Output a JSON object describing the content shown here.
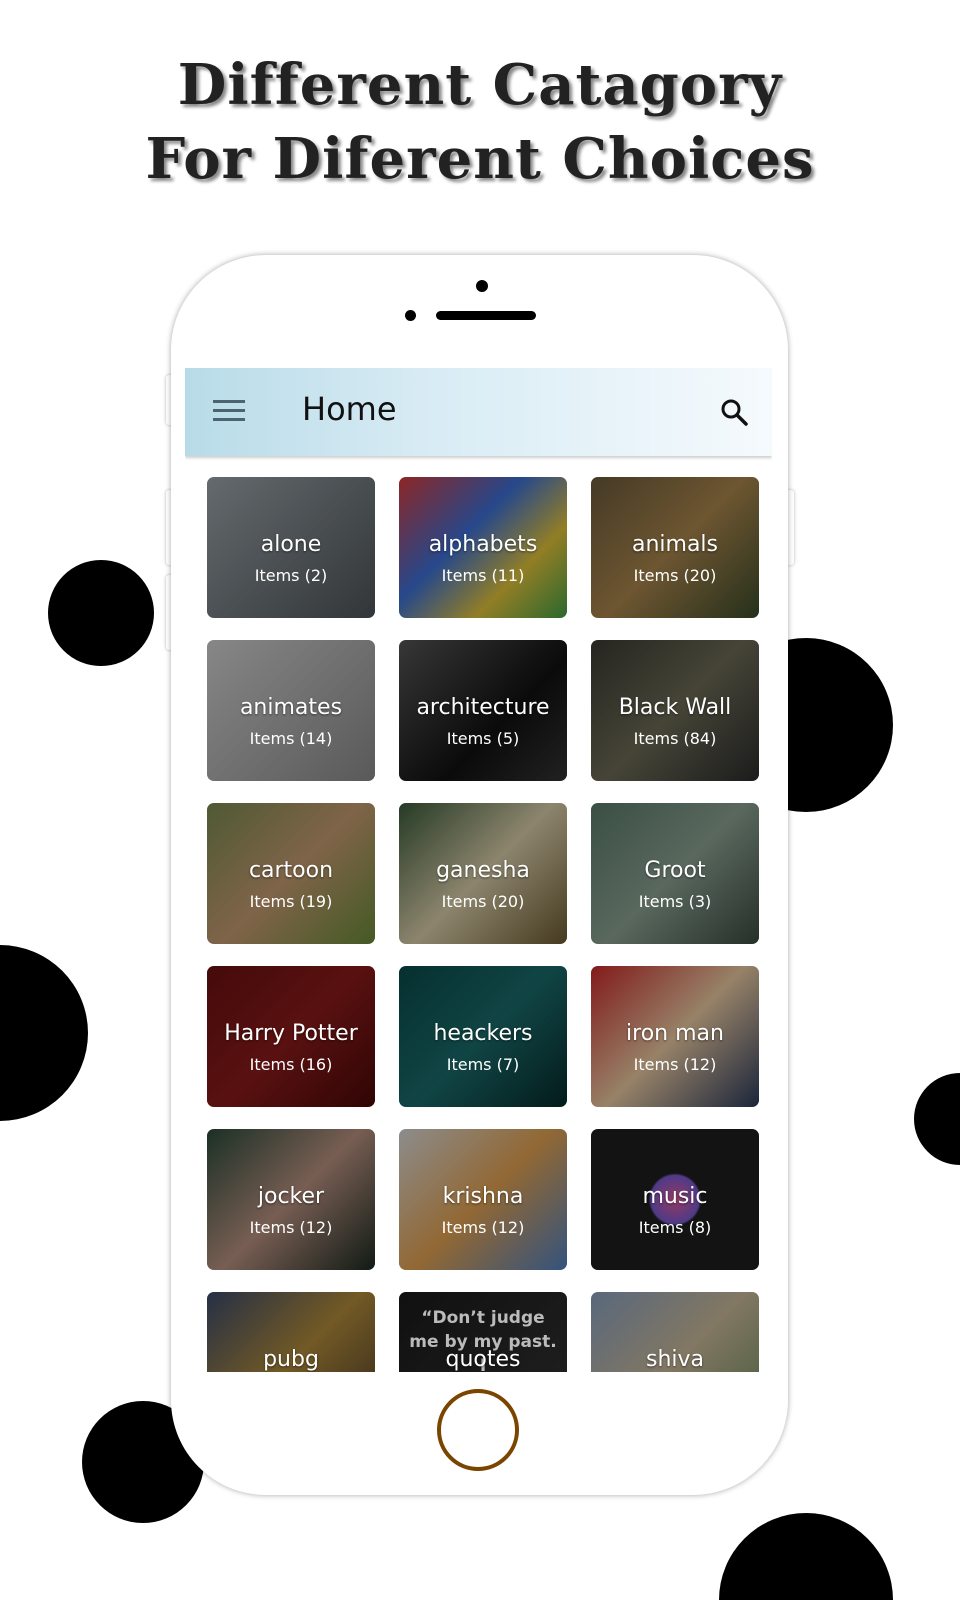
{
  "headline": {
    "line1": "Different Catagory",
    "line2": "For Diferent Choices"
  },
  "app": {
    "title": "Home",
    "menu_icon": "hamburger-menu-icon",
    "search_icon": "search-icon"
  },
  "categories": [
    {
      "name": "alone",
      "count": "Items (2)",
      "bg": "linear-gradient(135deg,#9aa3a8,#4d5358)"
    },
    {
      "name": "alphabets",
      "count": "Items (11)",
      "bg": "linear-gradient(135deg,#d63b3b,#3b6fd6 40%,#e0c23a 70%,#43a047)"
    },
    {
      "name": "animals",
      "count": "Items (20)",
      "bg": "linear-gradient(135deg,#6a5a3a,#a8844c 50%,#3a4a2a)"
    },
    {
      "name": "animates",
      "count": "Items (14)",
      "bg": "linear-gradient(135deg,#cfcfcf,#8a8a8a)"
    },
    {
      "name": "architecture",
      "count": "Items (5)",
      "bg": "linear-gradient(135deg,#555,#111 60%,#333)"
    },
    {
      "name": "Black Wall",
      "count": "Items (84)",
      "bg": "linear-gradient(135deg,#3a3a32,#6b6a55 50%,#2b2b2b)"
    },
    {
      "name": "cartoon",
      "count": "Items (19)",
      "bg": "linear-gradient(135deg,#7a8a50,#c49a70 50%,#6a8a3a)"
    },
    {
      "name": "ganesha",
      "count": "Items (20)",
      "bg": "linear-gradient(135deg,#3a5a3a,#d8cca8 50%,#6a5a30)"
    },
    {
      "name": "Groot",
      "count": "Items (3)",
      "bg": "linear-gradient(135deg,#5a7a6a,#8aa090 50%,#3a4a40)"
    },
    {
      "name": "Harry Potter",
      "count": "Items (16)",
      "bg": "linear-gradient(135deg,#6a1010,#8a1a1a 50%,#4a0808)"
    },
    {
      "name": "heackers",
      "count": "Items (7)",
      "bg": "linear-gradient(135deg,#0a4a4a,#1a6a6a 50%,#062a2a)"
    },
    {
      "name": "iron man",
      "count": "Items (12)",
      "bg": "linear-gradient(135deg,#c82a2a,#e8c8a0 50%,#2a3a5a)"
    },
    {
      "name": "jocker",
      "count": "Items (12)",
      "bg": "linear-gradient(135deg,#2a4a3a,#b89080 50%,#1a2a20)"
    },
    {
      "name": "krishna",
      "count": "Items (12)",
      "bg": "linear-gradient(135deg,#d8d8d8,#e0a050 50%,#5080c0)"
    },
    {
      "name": "music",
      "count": "Items (8)",
      "bg": "radial-gradient(circle at 50% 50%,#e05a9a 0,#7a5ad0 22%,#1e1e1e 24%)"
    },
    {
      "name": "pubg",
      "count": "",
      "bg": "linear-gradient(135deg,#3a4a6a,#b08a3a 50%,#4a3a2a)"
    },
    {
      "name": "quotes",
      "count": "",
      "bg": "linear-gradient(135deg,#1a1a1a,#333)"
    },
    {
      "name": "shiva",
      "count": "",
      "bg": "linear-gradient(135deg,#8aa0c0,#c8b898 50%,#6a8a5a)"
    }
  ],
  "quote_preview": "“Don’t judge me by my past. I"
}
